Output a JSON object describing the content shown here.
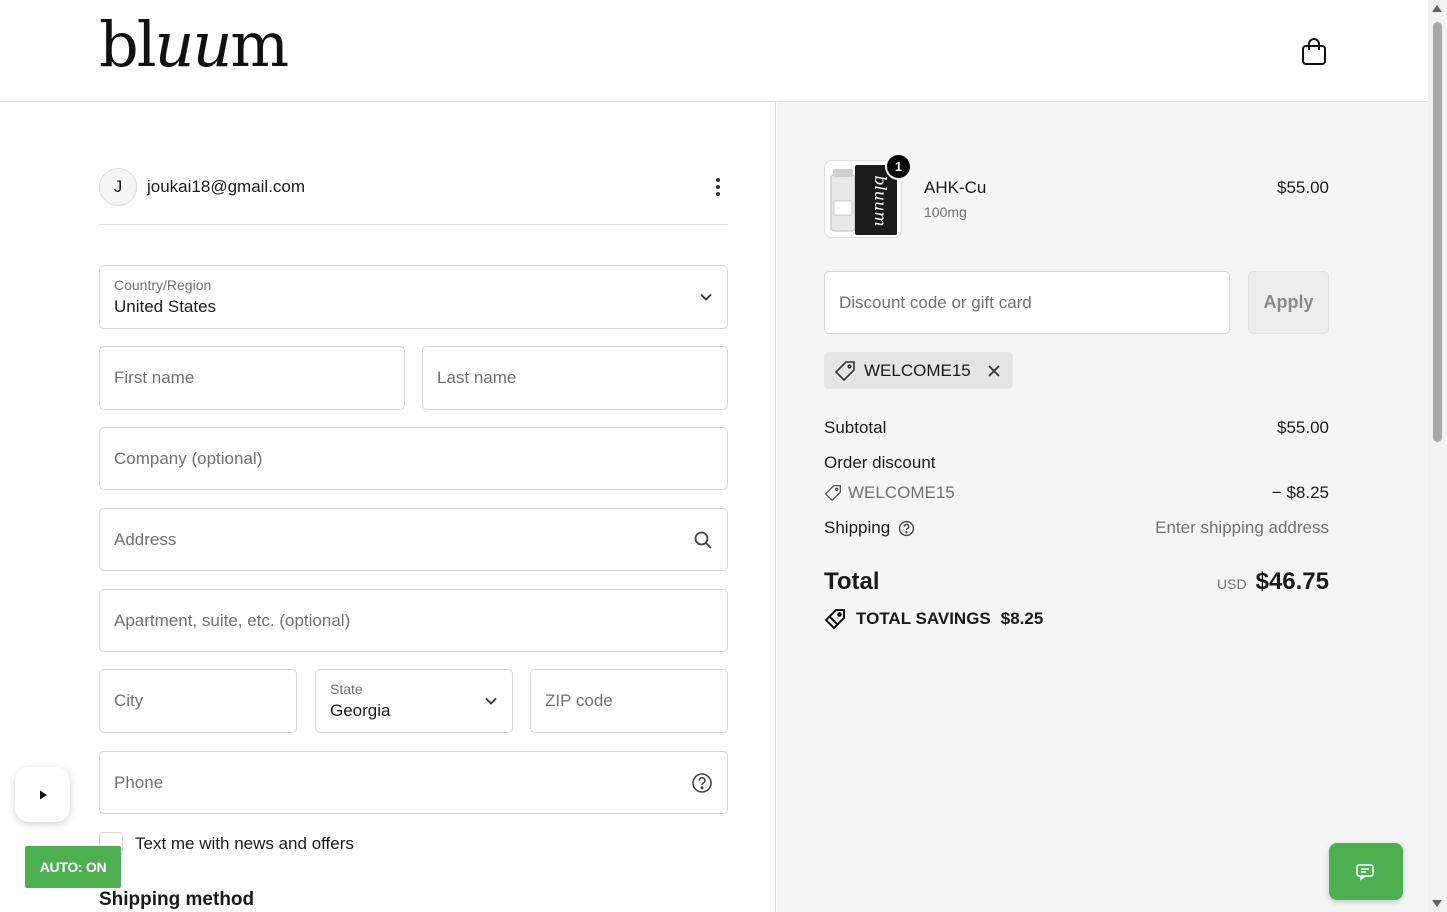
{
  "brand": {
    "logo_text_a": "bl",
    "logo_text_b": "uu",
    "logo_text_c": "m"
  },
  "header": {
    "cart_icon": "shopping-bag-icon"
  },
  "account": {
    "avatar_initial": "J",
    "email": "joukai18@gmail.com",
    "menu_icon": "kebab-menu-icon"
  },
  "form": {
    "country": {
      "label": "Country/Region",
      "value": "United States"
    },
    "first_name": {
      "placeholder": "First name"
    },
    "last_name": {
      "placeholder": "Last name"
    },
    "company": {
      "placeholder": "Company (optional)"
    },
    "address": {
      "placeholder": "Address"
    },
    "apartment": {
      "placeholder": "Apartment, suite, etc. (optional)"
    },
    "city": {
      "placeholder": "City"
    },
    "state": {
      "label": "State",
      "value": "Georgia"
    },
    "zip": {
      "placeholder": "ZIP code"
    },
    "phone": {
      "placeholder": "Phone"
    },
    "sms_optin": {
      "label": "Text me with news and offers",
      "checked": false
    },
    "shipping_method_title": "Shipping method"
  },
  "widgets": {
    "auto_label": "AUTO: ON",
    "auto_color": "#4caf50"
  },
  "order": {
    "product": {
      "name": "AHK-Cu",
      "variant": "100mg",
      "price": "$55.00",
      "quantity": "1"
    },
    "discount": {
      "placeholder": "Discount code or gift card",
      "apply_label": "Apply",
      "applied_code": "WELCOME15"
    },
    "subtotal": {
      "label": "Subtotal",
      "value": "$55.00"
    },
    "order_discount": {
      "label": "Order discount",
      "code": "WELCOME15",
      "value": "− $8.25"
    },
    "shipping": {
      "label": "Shipping",
      "value": "Enter shipping address"
    },
    "total": {
      "label": "Total",
      "currency": "USD",
      "value": "$46.75"
    },
    "savings": {
      "label": "TOTAL SAVINGS",
      "value": "$8.25"
    }
  }
}
